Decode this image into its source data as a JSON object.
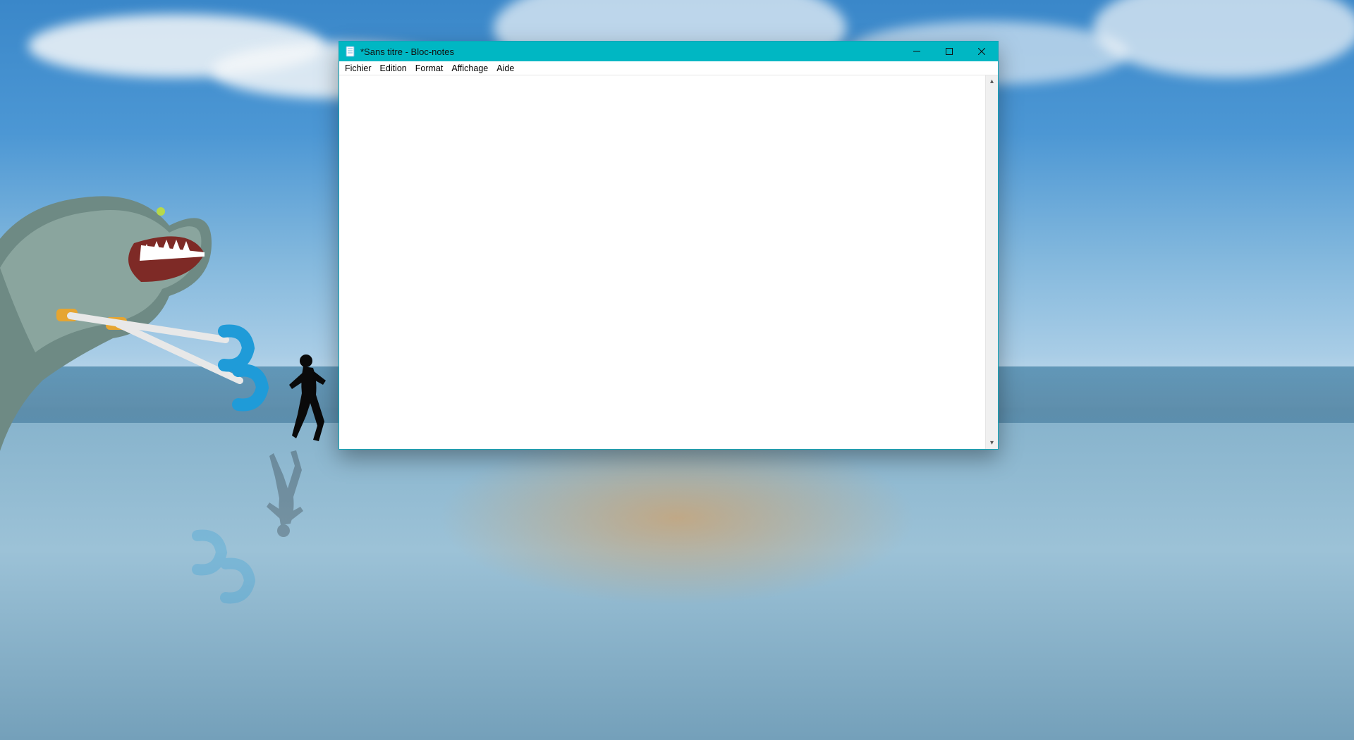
{
  "window": {
    "title": "*Sans titre - Bloc-notes"
  },
  "menus": {
    "file": "Fichier",
    "edit": "Edition",
    "format": "Format",
    "view": "Affichage",
    "help": "Aide"
  },
  "editor": {
    "content": ""
  }
}
